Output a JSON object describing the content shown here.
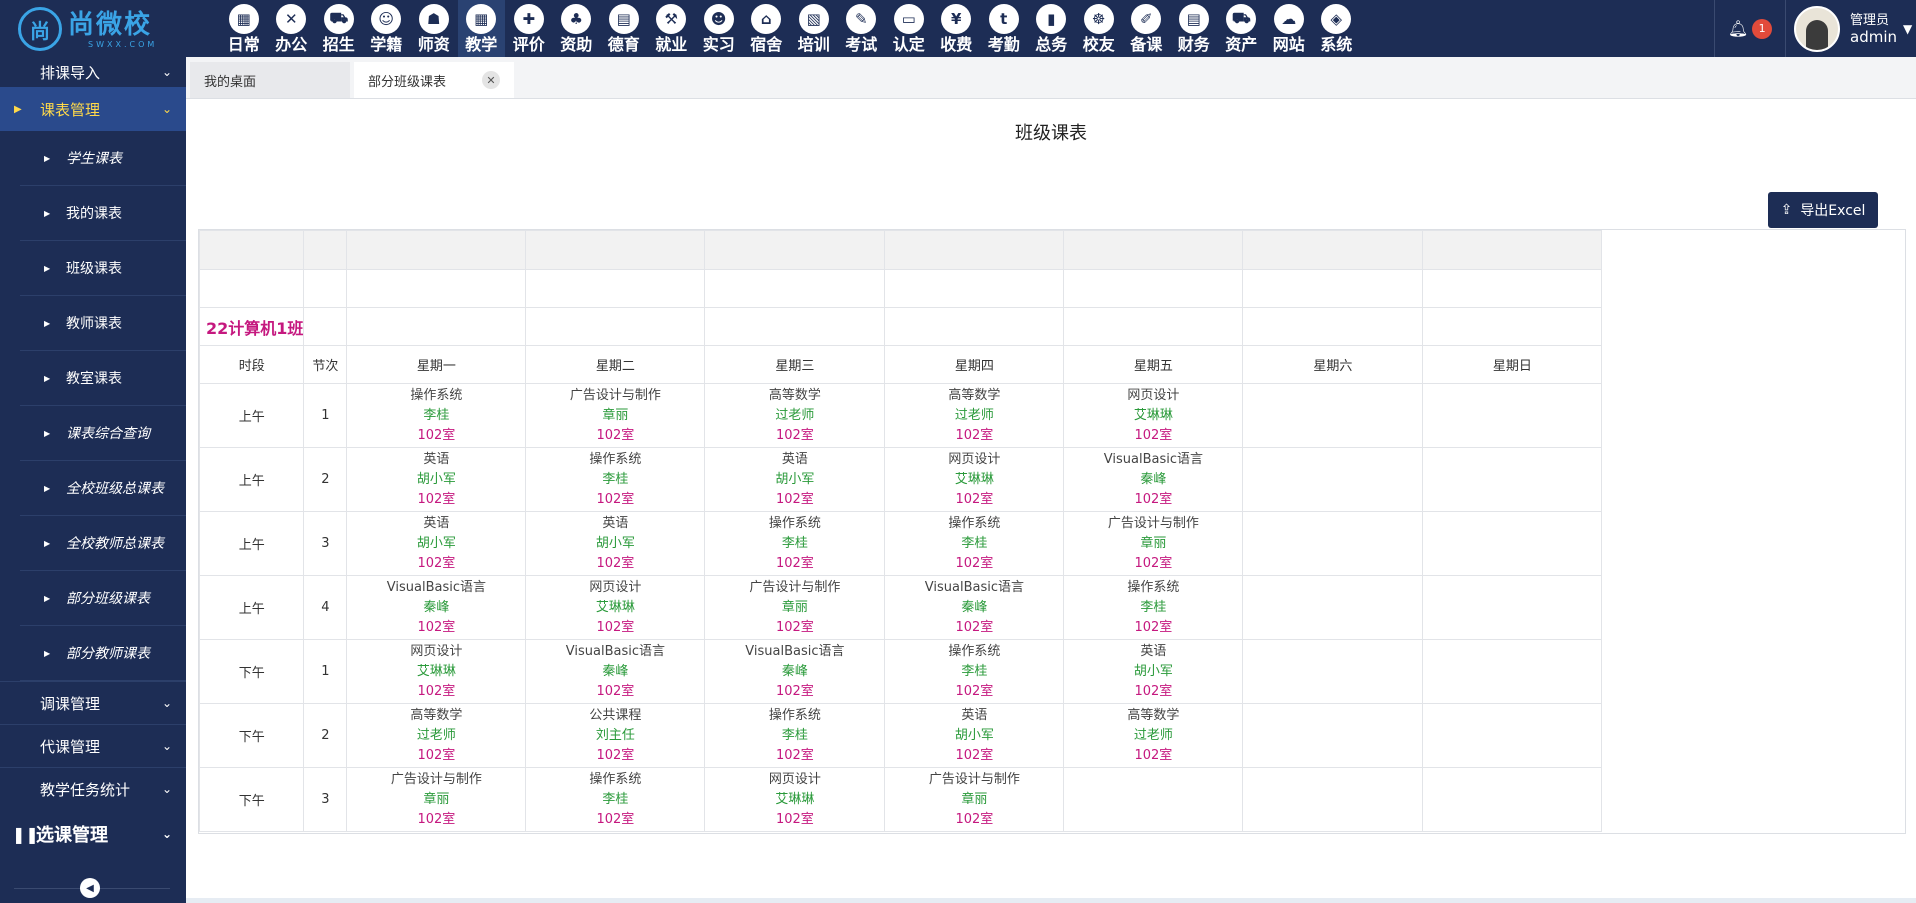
{
  "logo": {
    "mark": "尚",
    "name": "尚微校",
    "sub": "SWXX.COM"
  },
  "modules": [
    {
      "label": "日常",
      "icon": "▦"
    },
    {
      "label": "办公",
      "icon": "✕"
    },
    {
      "label": "招生",
      "icon": "⛟"
    },
    {
      "label": "学籍",
      "icon": "☺"
    },
    {
      "label": "师资",
      "icon": "☗"
    },
    {
      "label": "教学",
      "icon": "▦"
    },
    {
      "label": "评价",
      "icon": "✚"
    },
    {
      "label": "资助",
      "icon": "♣"
    },
    {
      "label": "德育",
      "icon": "▤"
    },
    {
      "label": "就业",
      "icon": "⚒"
    },
    {
      "label": "实习",
      "icon": "☻"
    },
    {
      "label": "宿舍",
      "icon": "⌂"
    },
    {
      "label": "培训",
      "icon": "▧"
    },
    {
      "label": "考试",
      "icon": "✎"
    },
    {
      "label": "认定",
      "icon": "▭"
    },
    {
      "label": "收费",
      "icon": "¥"
    },
    {
      "label": "考勤",
      "icon": "t"
    },
    {
      "label": "总务",
      "icon": "▮"
    },
    {
      "label": "校友",
      "icon": "☸"
    },
    {
      "label": "备课",
      "icon": "✐"
    },
    {
      "label": "财务",
      "icon": "▤"
    },
    {
      "label": "资产",
      "icon": "⛟"
    },
    {
      "label": "网站",
      "icon": "☁"
    },
    {
      "label": "系统",
      "icon": "◈"
    }
  ],
  "active_module": "教学",
  "notifications": {
    "count": "1"
  },
  "user": {
    "role": "管理员",
    "name": "admin"
  },
  "sidebar": {
    "top_item": "排课导入",
    "active_group": "课表管理",
    "sub_items": [
      {
        "label": "学生课表",
        "italic": true
      },
      {
        "label": "我的课表",
        "italic": false
      },
      {
        "label": "班级课表",
        "italic": false
      },
      {
        "label": "教师课表",
        "italic": false
      },
      {
        "label": "教室课表",
        "italic": false
      },
      {
        "label": "课表综合查询",
        "italic": true
      },
      {
        "label": "全校班级总课表",
        "italic": true
      },
      {
        "label": "全校教师总课表",
        "italic": true
      },
      {
        "label": "部分班级课表",
        "italic": true
      },
      {
        "label": "部分教师课表",
        "italic": true
      }
    ],
    "groups": [
      "调课管理",
      "代课管理",
      "教学任务统计"
    ],
    "big_group": "选课管理"
  },
  "tabs": [
    {
      "label": "我的桌面",
      "active": false
    },
    {
      "label": "部分班级课表",
      "active": true
    }
  ],
  "page": {
    "title": "班级课表",
    "export_label": "导出Excel",
    "class_name": "22计算机1班",
    "headers": [
      "时段",
      "节次",
      "星期一",
      "星期二",
      "星期三",
      "星期四",
      "星期五",
      "星期六",
      "星期日"
    ]
  },
  "timetable": [
    {
      "period": "上午",
      "num": "1",
      "cells": [
        {
          "s": "操作系统",
          "t": "李桂",
          "r": "102室"
        },
        {
          "s": "广告设计与制作",
          "t": "章丽",
          "r": "102室"
        },
        {
          "s": "高等数学",
          "t": "过老师",
          "r": "102室"
        },
        {
          "s": "高等数学",
          "t": "过老师",
          "r": "102室"
        },
        {
          "s": "网页设计",
          "t": "艾琳琳",
          "r": "102室"
        },
        null,
        null
      ]
    },
    {
      "period": "上午",
      "num": "2",
      "cells": [
        {
          "s": "英语",
          "t": "胡小军",
          "r": "102室"
        },
        {
          "s": "操作系统",
          "t": "李桂",
          "r": "102室"
        },
        {
          "s": "英语",
          "t": "胡小军",
          "r": "102室"
        },
        {
          "s": "网页设计",
          "t": "艾琳琳",
          "r": "102室"
        },
        {
          "s": "VisualBasic语言",
          "t": "秦峰",
          "r": "102室"
        },
        null,
        null
      ]
    },
    {
      "period": "上午",
      "num": "3",
      "cells": [
        {
          "s": "英语",
          "t": "胡小军",
          "r": "102室"
        },
        {
          "s": "英语",
          "t": "胡小军",
          "r": "102室"
        },
        {
          "s": "操作系统",
          "t": "李桂",
          "r": "102室"
        },
        {
          "s": "操作系统",
          "t": "李桂",
          "r": "102室"
        },
        {
          "s": "广告设计与制作",
          "t": "章丽",
          "r": "102室"
        },
        null,
        null
      ]
    },
    {
      "period": "上午",
      "num": "4",
      "cells": [
        {
          "s": "VisualBasic语言",
          "t": "秦峰",
          "r": "102室"
        },
        {
          "s": "网页设计",
          "t": "艾琳琳",
          "r": "102室"
        },
        {
          "s": "广告设计与制作",
          "t": "章丽",
          "r": "102室"
        },
        {
          "s": "VisualBasic语言",
          "t": "秦峰",
          "r": "102室"
        },
        {
          "s": "操作系统",
          "t": "李桂",
          "r": "102室"
        },
        null,
        null
      ]
    },
    {
      "period": "下午",
      "num": "1",
      "cells": [
        {
          "s": "网页设计",
          "t": "艾琳琳",
          "r": "102室"
        },
        {
          "s": "VisualBasic语言",
          "t": "秦峰",
          "r": "102室"
        },
        {
          "s": "VisualBasic语言",
          "t": "秦峰",
          "r": "102室"
        },
        {
          "s": "操作系统",
          "t": "李桂",
          "r": "102室"
        },
        {
          "s": "英语",
          "t": "胡小军",
          "r": "102室"
        },
        null,
        null
      ]
    },
    {
      "period": "下午",
      "num": "2",
      "cells": [
        {
          "s": "高等数学",
          "t": "过老师",
          "r": "102室"
        },
        {
          "s": "公共课程",
          "t": "刘主任",
          "r": "102室"
        },
        {
          "s": "操作系统",
          "t": "李桂",
          "r": "102室"
        },
        {
          "s": "英语",
          "t": "胡小军",
          "r": "102室"
        },
        {
          "s": "高等数学",
          "t": "过老师",
          "r": "102室"
        },
        null,
        null
      ]
    },
    {
      "period": "下午",
      "num": "3",
      "cells": [
        {
          "s": "广告设计与制作",
          "t": "章丽",
          "r": "102室"
        },
        {
          "s": "操作系统",
          "t": "李桂",
          "r": "102室"
        },
        {
          "s": "网页设计",
          "t": "艾琳琳",
          "r": "102室"
        },
        {
          "s": "广告设计与制作",
          "t": "章丽",
          "r": "102室"
        },
        null,
        null,
        null
      ]
    }
  ]
}
